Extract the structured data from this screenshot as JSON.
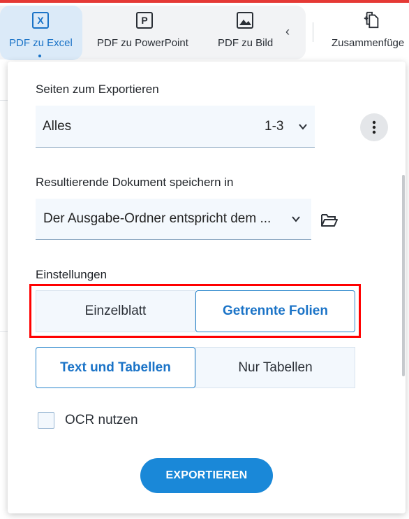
{
  "toolbar": {
    "items": [
      {
        "label": "PDF zu Excel",
        "icon": "excel-x-icon",
        "active": true
      },
      {
        "label": "PDF zu PowerPoint",
        "icon": "powerpoint-p-icon",
        "active": false
      },
      {
        "label": "PDF zu Bild",
        "icon": "image-icon",
        "active": false
      },
      {
        "label": "Zusammenfüge",
        "icon": "merge-documents-icon",
        "active": false
      }
    ],
    "icon_letters": {
      "excel": "X",
      "powerpoint": "P"
    }
  },
  "panel": {
    "pages_heading": "Seiten zum Exportieren",
    "pages_value": "Alles",
    "pages_range": "1-3",
    "save_heading": "Resultierende Dokument speichern in",
    "save_value": "Der Ausgabe-Ordner entspricht dem ...",
    "settings_heading": "Einstellungen",
    "layout_options": [
      {
        "label": "Einzelblatt",
        "selected": false
      },
      {
        "label": "Getrennte Folien",
        "selected": true
      }
    ],
    "content_options": [
      {
        "label": "Text und Tabellen",
        "selected": true
      },
      {
        "label": "Nur Tabellen",
        "selected": false
      }
    ],
    "ocr_label": "OCR nutzen",
    "ocr_checked": false,
    "export_label": "EXPORTIEREN"
  },
  "colors": {
    "accent": "#1a88d8",
    "highlight": "#ff0000",
    "field_bg": "#f3f8fd"
  }
}
